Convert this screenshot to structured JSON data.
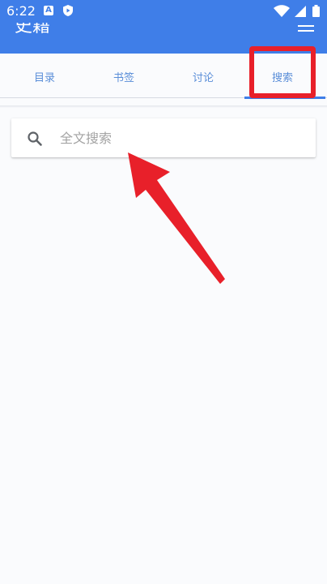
{
  "status_bar": {
    "time": "6:22",
    "notification_a": "A",
    "icons": [
      "a-notification-icon",
      "play-protect-icon",
      "wifi-icon",
      "signal-icon",
      "battery-icon"
    ]
  },
  "app_bar": {
    "title": "史籍",
    "menu_icon": "menu-icon"
  },
  "tabs": [
    {
      "label": "目录"
    },
    {
      "label": "书签"
    },
    {
      "label": "讨论"
    },
    {
      "label": "搜索"
    }
  ],
  "selected_tab": "搜索",
  "search": {
    "placeholder": "全文搜索",
    "value": "",
    "icon": "search-icon"
  },
  "annotations": {
    "highlight_color": "#e8202a",
    "arrow_color": "#e8202a"
  },
  "colors": {
    "primary": "#3f7ee8",
    "tab_text": "#5a8ed8",
    "background": "#fafbfd"
  }
}
